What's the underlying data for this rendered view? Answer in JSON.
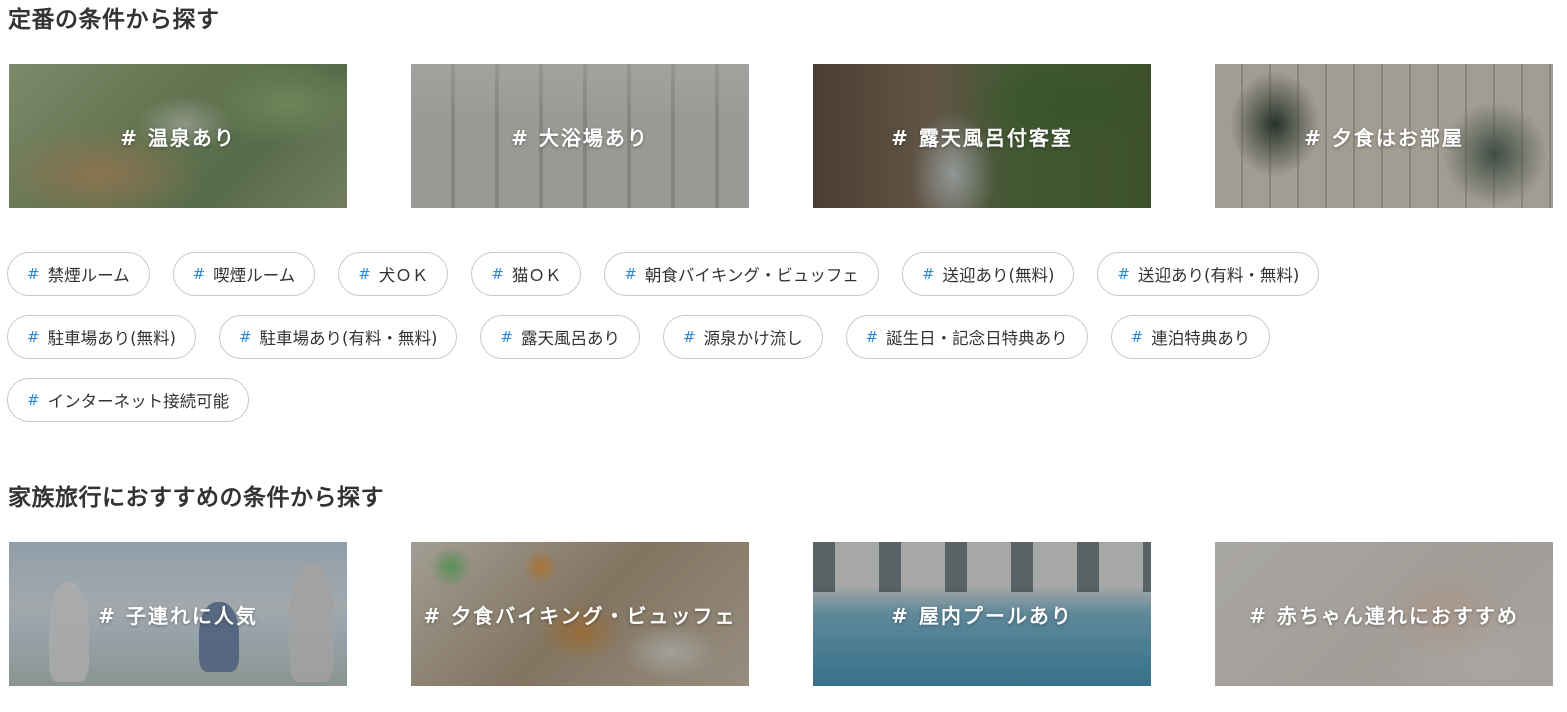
{
  "sections": [
    {
      "title": "定番の条件から探す",
      "cards": [
        {
          "label": "# 温泉あり"
        },
        {
          "label": "# 大浴場あり"
        },
        {
          "label": "# 露天風呂付客室"
        },
        {
          "label": "# 夕食はお部屋"
        }
      ]
    },
    {
      "title": "家族旅行におすすめの条件から探す",
      "cards": [
        {
          "label": "# 子連れに人気"
        },
        {
          "label": "# 夕食バイキング・ビュッフェ"
        },
        {
          "label": "# 屋内プールあり"
        },
        {
          "label": "# 赤ちゃん連れにおすすめ"
        }
      ]
    }
  ],
  "tags": {
    "hash": "#",
    "rows": [
      [
        "禁煙ルーム",
        "喫煙ルーム",
        "犬ＯＫ",
        "猫ＯＫ",
        "朝食バイキング・ビュッフェ",
        "送迎あり(無料)",
        "送迎あり(有料・無料)"
      ],
      [
        "駐車場あり(無料)",
        "駐車場あり(有料・無料)",
        "露天風呂あり",
        "源泉かけ流し",
        "誕生日・記念日特典あり",
        "連泊特典あり"
      ],
      [
        "インターネット接続可能"
      ]
    ]
  },
  "colors": {
    "hash_accent": "#2a8ad9",
    "chip_border": "#c8c8c8",
    "text": "#333333"
  }
}
